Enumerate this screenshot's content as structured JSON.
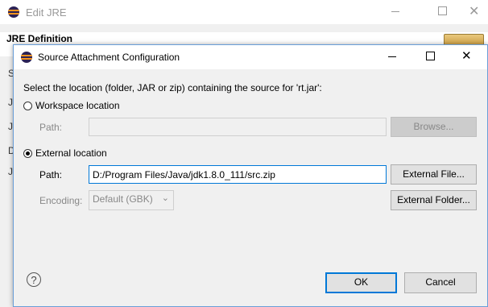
{
  "background_window": {
    "title": "Edit JRE",
    "heading": "JRE Definition",
    "side_letters": [
      "S",
      "J",
      "J",
      "D",
      "J"
    ]
  },
  "dialog": {
    "title": "Source Attachment Configuration",
    "instruction": "Select the location (folder, JAR or zip) containing the source for 'rt.jar':",
    "workspace": {
      "label": "Workspace location",
      "selected": false,
      "path_label": "Path:",
      "path_value": "",
      "browse_label": "Browse..."
    },
    "external": {
      "label": "External location",
      "selected": true,
      "path_label": "Path:",
      "path_value": "D:/Program Files/Java/jdk1.8.0_111/src.zip",
      "external_file_label": "External File...",
      "encoding_label": "Encoding:",
      "encoding_value": "Default (GBK)",
      "external_folder_label": "External Folder..."
    },
    "help_icon": "?",
    "ok_label": "OK",
    "cancel_label": "Cancel"
  },
  "icons": {
    "app": "eclipse-icon",
    "help": "help-icon",
    "close": "close-icon",
    "maximize": "maximize-icon",
    "minimize": "minimize-icon"
  },
  "colors": {
    "accent": "#0078d7",
    "dialog_border": "#6a9ed8"
  }
}
